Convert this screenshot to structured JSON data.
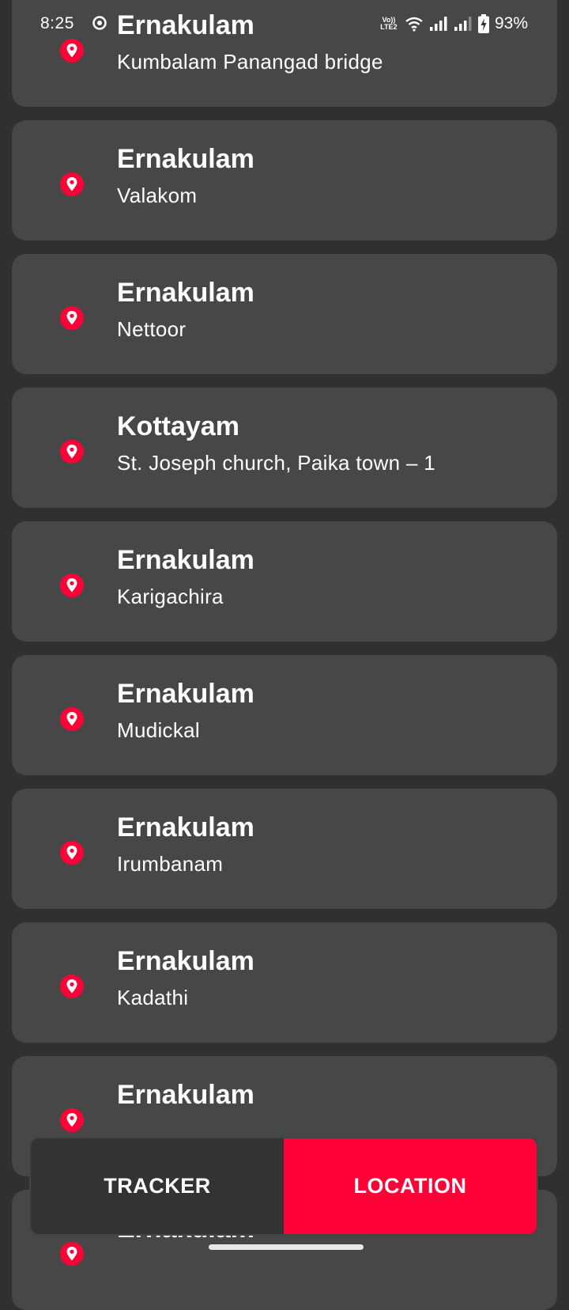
{
  "status_bar": {
    "time": "8:25",
    "volte_line1": "Vo))",
    "volte_line2": "LTE2",
    "battery_percent": "93%",
    "icons": [
      "sync-icon",
      "wifi-icon",
      "signal-icon",
      "signal-icon",
      "battery-charging-icon"
    ]
  },
  "locations": [
    {
      "city": "Ernakulam",
      "place": "Kumbalam Panangad bridge"
    },
    {
      "city": "Ernakulam",
      "place": "Valakom"
    },
    {
      "city": "Ernakulam",
      "place": "Nettoor"
    },
    {
      "city": "Kottayam",
      "place": "St. Joseph church, Paika town – 1"
    },
    {
      "city": "Ernakulam",
      "place": "Karigachira"
    },
    {
      "city": "Ernakulam",
      "place": "Mudickal"
    },
    {
      "city": "Ernakulam",
      "place": "Irumbanam"
    },
    {
      "city": "Ernakulam",
      "place": "Kadathi"
    },
    {
      "city": "Ernakulam",
      "place": ""
    },
    {
      "city": "Ernakulam",
      "place": ""
    }
  ],
  "pin_icon": "location-pin-icon",
  "bottom_nav": {
    "tracker_label": "TRACKER",
    "location_label": "LOCATION",
    "active": "location"
  },
  "colors": {
    "background": "#303030",
    "card": "#474747",
    "accent": "#ff0037",
    "inactive_tab": "#333333"
  }
}
